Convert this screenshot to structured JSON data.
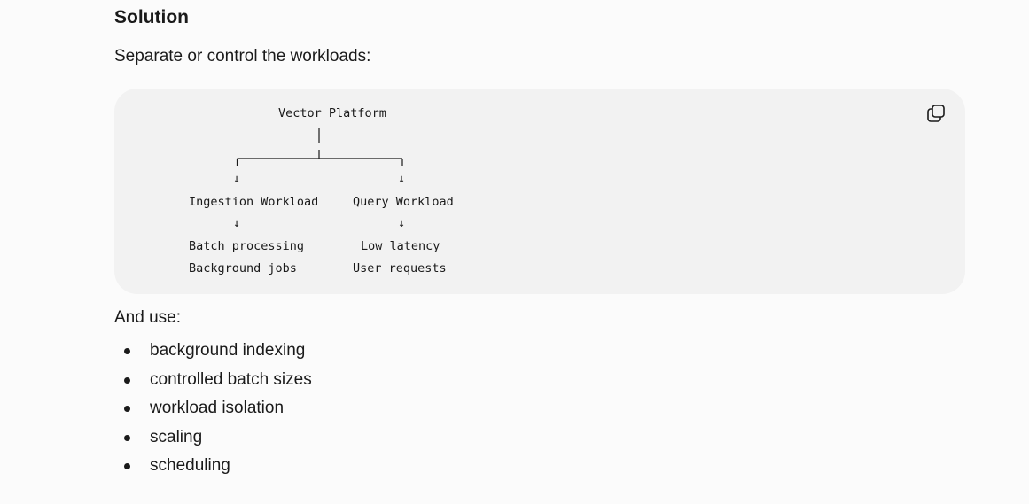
{
  "heading": "Solution",
  "intro": "Separate or control the workloads:",
  "code_block": {
    "root": "Vector Platform",
    "left_branch": {
      "arrow": "↓",
      "label": "Ingestion Workload",
      "sub_arrow": "↓",
      "items": [
        "Batch processing",
        "Background jobs"
      ]
    },
    "right_branch": {
      "arrow": "↓",
      "label": "Query Workload",
      "sub_arrow": "↓",
      "items": [
        "Low latency",
        "User requests"
      ]
    },
    "copy_icon": "copy-icon"
  },
  "after_text": "And use:",
  "bullets": [
    "background indexing",
    "controlled batch sizes",
    "workload isolation",
    "scaling",
    "scheduling"
  ]
}
